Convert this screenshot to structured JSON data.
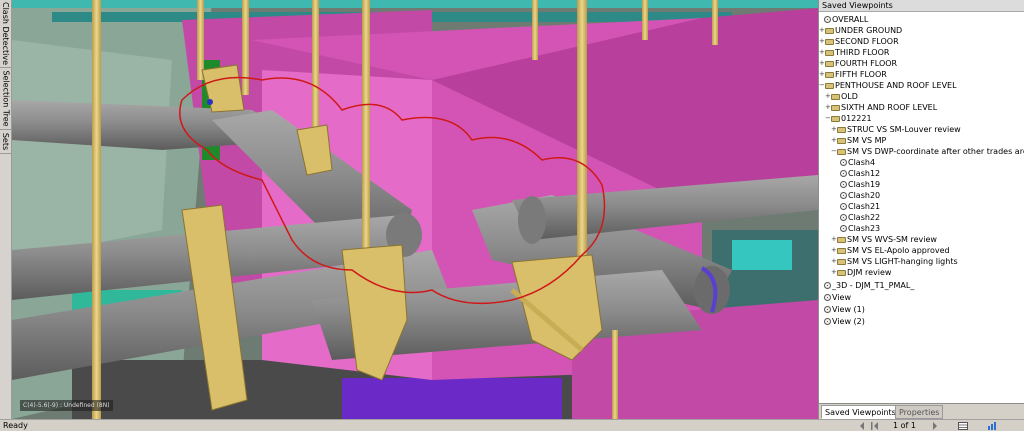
{
  "left_tabs": [
    {
      "label": "Clash Detective"
    },
    {
      "label": "Selection Tree"
    },
    {
      "label": "Sets"
    }
  ],
  "viewport": {
    "coord_readout": "C(4)-5.6(-9) : Undefined (8N)"
  },
  "saved_viewpoints": {
    "title": "Saved Viewpoints",
    "items": [
      {
        "label": "OVERALL"
      },
      {
        "label": "UNDER GROUND"
      },
      {
        "label": "SECOND FLOOR"
      },
      {
        "label": "THIRD FLOOR"
      },
      {
        "label": "FOURTH FLOOR"
      },
      {
        "label": "FIFTH FLOOR"
      },
      {
        "label": "PENTHOUSE AND ROOF LEVEL"
      },
      {
        "label": "OLD"
      },
      {
        "label": "SIXTH AND ROOF LEVEL"
      },
      {
        "label": "012221"
      },
      {
        "label": "STRUC VS SM-Louver review"
      },
      {
        "label": "SM VS MP"
      },
      {
        "label": "SM VS DWP-coordinate after other trades are in"
      },
      {
        "label": "Clash4"
      },
      {
        "label": "Clash12"
      },
      {
        "label": "Clash19"
      },
      {
        "label": "Clash20"
      },
      {
        "label": "Clash21"
      },
      {
        "label": "Clash22"
      },
      {
        "label": "Clash23"
      },
      {
        "label": "SM VS WVS-SM review"
      },
      {
        "label": "SM VS EL-Apolo approved"
      },
      {
        "label": "SM VS LIGHT-hanging lights"
      },
      {
        "label": "DJM review"
      },
      {
        "label": "_3D - DJM_T1_PMAL_"
      },
      {
        "label": "View"
      },
      {
        "label": "View (1)"
      },
      {
        "label": "View (2)"
      }
    ]
  },
  "panel_tabs": [
    {
      "label": "Saved Viewpoints"
    },
    {
      "label": "Properties"
    }
  ],
  "status": {
    "text": "Ready",
    "page_indicator": "1 of 1"
  },
  "colors": {
    "duct_magenta": "#d354b4",
    "pipe_gray": "#8c8c8c",
    "hanger_tan": "#d9bf6a",
    "markup_red": "#d01818"
  }
}
